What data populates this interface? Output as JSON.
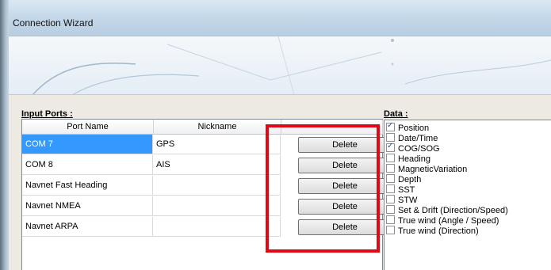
{
  "window": {
    "title": "Connection Wizard"
  },
  "input_ports": {
    "label": "Input Ports :",
    "columns": [
      "Port Name",
      "Nickname"
    ],
    "rows": [
      {
        "port": "COM 7",
        "nickname": "GPS",
        "action": "Delete",
        "selected": true
      },
      {
        "port": "COM 8",
        "nickname": "AIS",
        "action": "Delete",
        "selected": false
      },
      {
        "port": "Navnet Fast Heading",
        "nickname": "",
        "action": "Delete",
        "selected": false
      },
      {
        "port": "Navnet NMEA",
        "nickname": "",
        "action": "Delete",
        "selected": false
      },
      {
        "port": "Navnet ARPA",
        "nickname": "",
        "action": "Delete",
        "selected": false
      }
    ]
  },
  "data_section": {
    "label": "Data :",
    "items": [
      {
        "label": "Position",
        "checked": true
      },
      {
        "label": "Date/Time",
        "checked": false
      },
      {
        "label": "COG/SOG",
        "checked": true
      },
      {
        "label": "Heading",
        "checked": false
      },
      {
        "label": "MagneticVariation",
        "checked": false
      },
      {
        "label": "Depth",
        "checked": false
      },
      {
        "label": "SST",
        "checked": false
      },
      {
        "label": "STW",
        "checked": false
      },
      {
        "label": "Set & Drift (Direction/Speed)",
        "checked": false
      },
      {
        "label": "True wind (Angle / Speed)",
        "checked": false
      },
      {
        "label": "True wind (Direction)",
        "checked": false
      }
    ]
  },
  "colors": {
    "highlight": "#e30613",
    "selection": "#3399ff"
  }
}
